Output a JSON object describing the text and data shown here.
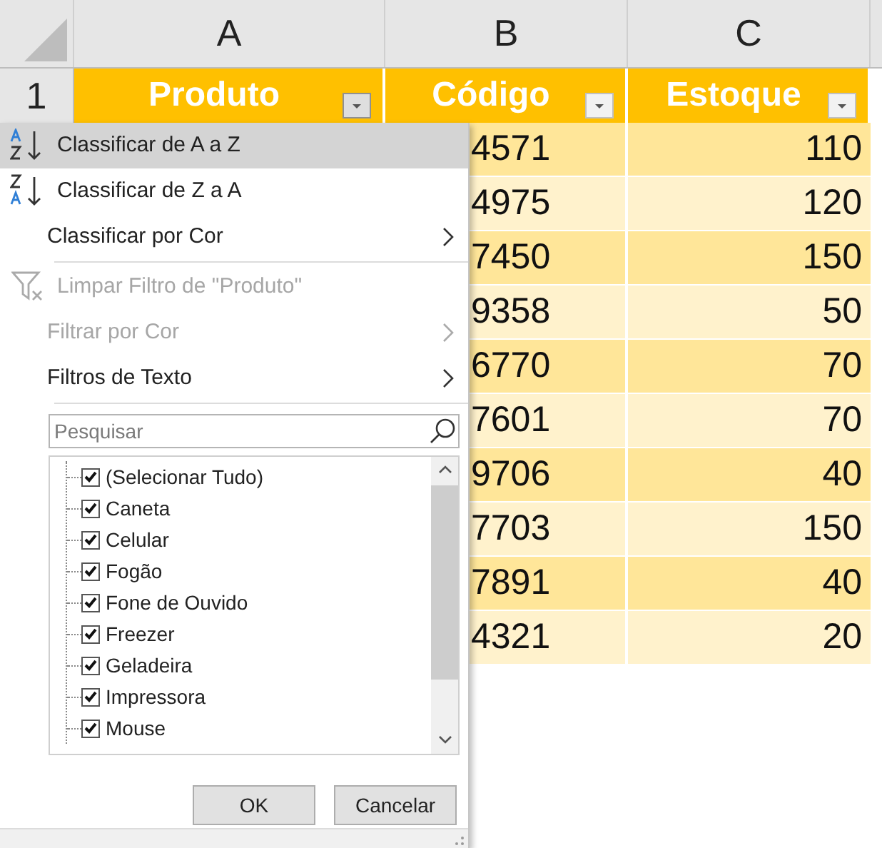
{
  "column_headers": [
    {
      "label": "A"
    },
    {
      "label": "B"
    },
    {
      "label": "C"
    }
  ],
  "row_number": "1",
  "table": {
    "columns": [
      {
        "label": "Produto",
        "filter_active": true
      },
      {
        "label": "Código",
        "filter_active": false
      },
      {
        "label": "Estoque",
        "filter_active": false
      }
    ],
    "rows": [
      {
        "code": "4571",
        "stock": "110"
      },
      {
        "code": "4975",
        "stock": "120"
      },
      {
        "code": "7450",
        "stock": "150"
      },
      {
        "code": "9358",
        "stock": "50"
      },
      {
        "code": "6770",
        "stock": "70"
      },
      {
        "code": "7601",
        "stock": "70"
      },
      {
        "code": "9706",
        "stock": "40"
      },
      {
        "code": "7703",
        "stock": "150"
      },
      {
        "code": "7891",
        "stock": "40"
      },
      {
        "code": "4321",
        "stock": "20"
      }
    ]
  },
  "filter_menu": {
    "items": [
      {
        "kind": "sort-asc",
        "label": "Classificar de A a Z",
        "selected": true,
        "disabled": false,
        "submenu": false
      },
      {
        "kind": "sort-desc",
        "label": "Classificar de Z a A",
        "selected": false,
        "disabled": false,
        "submenu": false
      },
      {
        "kind": "plain",
        "label": "Classificar por Cor",
        "selected": false,
        "disabled": false,
        "submenu": true
      },
      {
        "kind": "divider"
      },
      {
        "kind": "clear-filter",
        "label": "Limpar Filtro de \"Produto\"",
        "selected": false,
        "disabled": true,
        "submenu": false
      },
      {
        "kind": "plain",
        "label": "Filtrar por Cor",
        "selected": false,
        "disabled": true,
        "submenu": true
      },
      {
        "kind": "plain",
        "label": "Filtros de Texto",
        "selected": false,
        "disabled": false,
        "submenu": true
      },
      {
        "kind": "divider"
      }
    ],
    "search": {
      "placeholder": "Pesquisar"
    },
    "values": [
      {
        "label": "(Selecionar Tudo)",
        "checked": true
      },
      {
        "label": "Caneta",
        "checked": true
      },
      {
        "label": "Celular",
        "checked": true
      },
      {
        "label": "Fogão",
        "checked": true
      },
      {
        "label": "Fone de Ouvido",
        "checked": true
      },
      {
        "label": "Freezer",
        "checked": true
      },
      {
        "label": "Geladeira",
        "checked": true
      },
      {
        "label": "Impressora",
        "checked": true
      },
      {
        "label": "Mouse",
        "checked": true
      }
    ],
    "buttons": [
      "OK",
      "Cancelar"
    ]
  }
}
